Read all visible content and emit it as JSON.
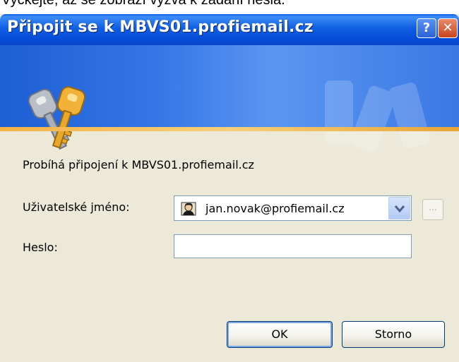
{
  "background_text": "Vyčkejte, až se zobrazí výzva k zadání hesla.",
  "dialog": {
    "title": "Připojit se k MBVS01.profiemail.cz",
    "help_button": "?",
    "close_button": "✕",
    "status_text": "Probíhá připojení k MBVS01.profiemail.cz",
    "username_label": "Uživatelské jméno:",
    "username_value": "jan.novak@profiemail.cz",
    "browse_button": "...",
    "password_label": "Heslo:",
    "password_value": "",
    "ok_label": "OK",
    "cancel_label": "Storno"
  },
  "icons": {
    "banner": "keys-icon",
    "user": "user-avatar-icon",
    "dropdown": "chevron-down-icon"
  },
  "colors": {
    "titlebar": "#0a5ae8",
    "banner": "#3577e6",
    "accent_line": "#f4b244",
    "dialog_bg": "#ece9d8"
  }
}
